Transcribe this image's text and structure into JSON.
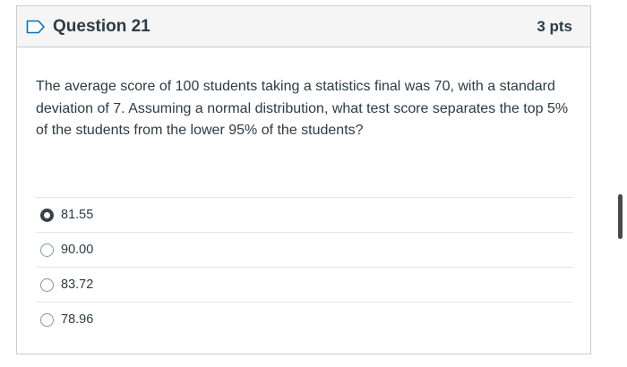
{
  "question": {
    "title": "Question 21",
    "points": "3 pts",
    "text": "The average score of 100 students taking a statistics final was 70, with a standard deviation of 7. Assuming a normal distribution, what test score separates the top 5% of the students from the lower 95% of the students?",
    "flag_icon": "bookmark-flag-icon"
  },
  "answers": [
    {
      "label": "81.55",
      "selected": true
    },
    {
      "label": "90.00",
      "selected": false
    },
    {
      "label": "83.72",
      "selected": false
    },
    {
      "label": "78.96",
      "selected": false
    }
  ],
  "colors": {
    "text": "#2d3b45",
    "header_bg": "#f5f5f5",
    "border": "#c7cdd1",
    "flag": "#0374b5"
  }
}
